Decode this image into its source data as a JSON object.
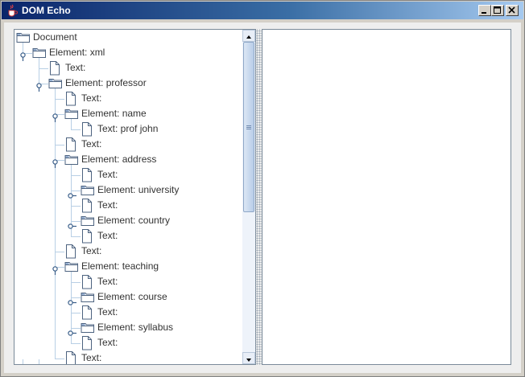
{
  "window": {
    "title": "DOM Echo"
  },
  "tree": {
    "nodes": [
      {
        "label": "Document",
        "type": "folder",
        "depth": 0,
        "expanded": true
      },
      {
        "label": "Element: xml",
        "type": "folder",
        "depth": 1,
        "expanded": true
      },
      {
        "label": "Text:",
        "type": "file",
        "depth": 2
      },
      {
        "label": "Element: professor",
        "type": "folder",
        "depth": 2,
        "expanded": true
      },
      {
        "label": "Text:",
        "type": "file",
        "depth": 3
      },
      {
        "label": "Element: name",
        "type": "folder",
        "depth": 3,
        "expanded": true
      },
      {
        "label": "Text: prof john",
        "type": "file",
        "depth": 4
      },
      {
        "label": "Text:",
        "type": "file",
        "depth": 3
      },
      {
        "label": "Element: address",
        "type": "folder",
        "depth": 3,
        "expanded": true
      },
      {
        "label": "Text:",
        "type": "file",
        "depth": 4
      },
      {
        "label": "Element: university",
        "type": "folder",
        "depth": 4,
        "expanded": false
      },
      {
        "label": "Text:",
        "type": "file",
        "depth": 4
      },
      {
        "label": "Element: country",
        "type": "folder",
        "depth": 4,
        "expanded": false
      },
      {
        "label": "Text:",
        "type": "file",
        "depth": 4
      },
      {
        "label": "Text:",
        "type": "file",
        "depth": 3
      },
      {
        "label": "Element: teaching",
        "type": "folder",
        "depth": 3,
        "expanded": true
      },
      {
        "label": "Text:",
        "type": "file",
        "depth": 4
      },
      {
        "label": "Element: course",
        "type": "folder",
        "depth": 4,
        "expanded": false
      },
      {
        "label": "Text:",
        "type": "file",
        "depth": 4
      },
      {
        "label": "Element: syllabus",
        "type": "folder",
        "depth": 4,
        "expanded": false
      },
      {
        "label": "Text:",
        "type": "file",
        "depth": 4
      },
      {
        "label": "Text:",
        "type": "file",
        "depth": 3
      }
    ]
  },
  "scrollbar": {
    "position": 0.0,
    "visible_fraction": 0.55
  },
  "colors": {
    "title_start": "#0a246a",
    "title_end": "#a6caf0",
    "tree_line": "#b8cfe5",
    "pane_border": "#7a8a99"
  },
  "icons": {
    "app": "java-cup-icon",
    "folder": "folder-icon",
    "file": "document-icon",
    "expanded": "expanded-handle-icon",
    "collapsed": "collapsed-handle-icon"
  }
}
